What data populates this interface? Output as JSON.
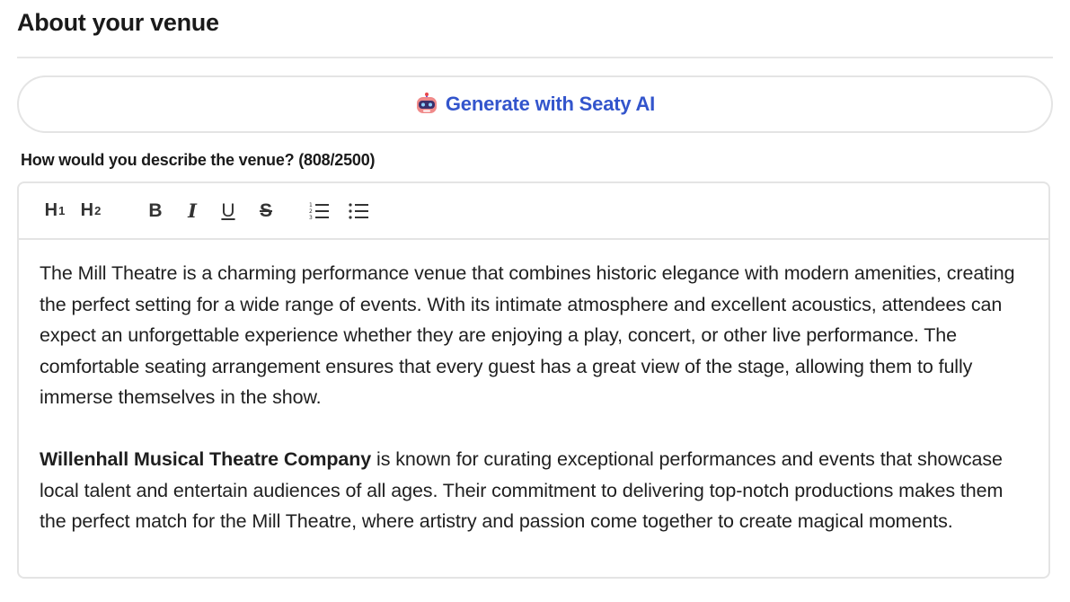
{
  "section": {
    "title": "About your venue"
  },
  "ai_button": {
    "icon": "robot-icon",
    "label": "Generate with Seaty AI",
    "accent_color": "#3355cc"
  },
  "field": {
    "label": "How would you describe the venue? (808/2500)"
  },
  "toolbar": {
    "h1": "H",
    "h1_sub": "1",
    "h2": "H",
    "h2_sub": "2",
    "bold": "B",
    "italic": "I",
    "underline": "U",
    "strike": "S",
    "ordered_list_icon": "ordered-list-icon",
    "bullet_list_icon": "bullet-list-icon"
  },
  "content": {
    "paragraph1": "The Mill Theatre is a charming performance venue that combines historic elegance with modern amenities, creating the perfect setting for a wide range of events. With its intimate atmosphere and excellent acoustics, attendees can expect an unforgettable experience whether they are enjoying a play, concert, or other live performance. The comfortable seating arrangement ensures that every guest has a great view of the stage, allowing them to fully immerse themselves in the show.",
    "paragraph2_bold": "Willenhall Musical Theatre Company",
    "paragraph2_rest": " is known for curating exceptional performances and events that showcase local talent and entertain audiences of all ages. Their commitment to delivering top-notch productions makes them the perfect match for the Mill Theatre, where artistry and passion come together to create magical moments."
  }
}
